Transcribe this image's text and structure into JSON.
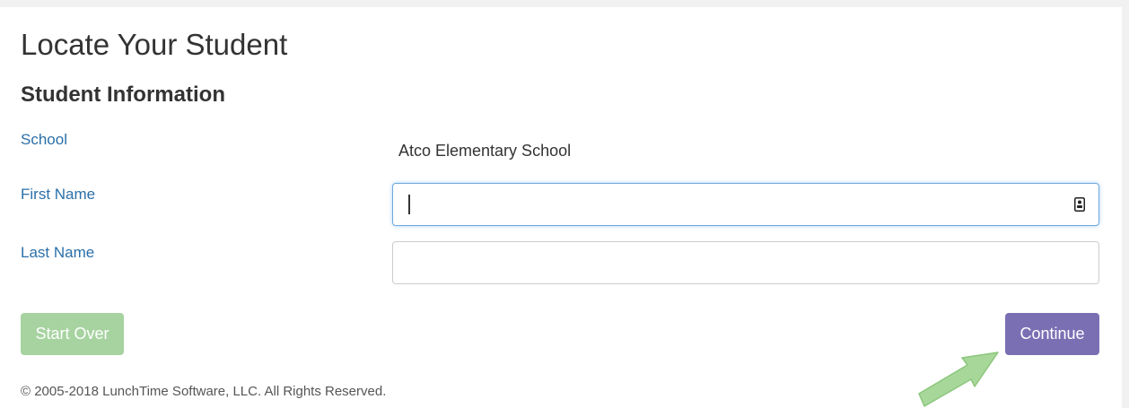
{
  "header": {
    "title": "Locate Your Student"
  },
  "form": {
    "section_title": "Student Information",
    "school": {
      "label": "School",
      "value": "Atco Elementary School"
    },
    "first_name": {
      "label": "First Name",
      "value": ""
    },
    "last_name": {
      "label": "Last Name",
      "value": ""
    }
  },
  "actions": {
    "start_over_label": "Start Over",
    "continue_label": "Continue"
  },
  "footer": {
    "copyright": "© 2005-2018 LunchTime Software, LLC. All Rights Reserved."
  },
  "colors": {
    "label_blue": "#2a6fa8",
    "start_over_green": "#a6d3a0",
    "continue_purple": "#7b6fb4",
    "arrow_green": "#a8d79a"
  },
  "icons": {
    "autofill": "autofill-contact-icon",
    "pointer_arrow": "pointer-arrow"
  }
}
